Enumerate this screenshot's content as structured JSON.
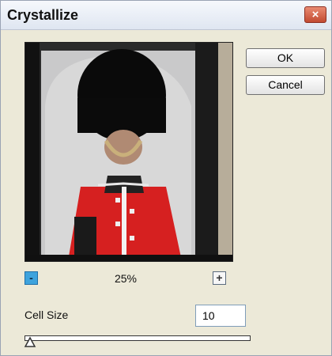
{
  "dialog": {
    "title": "Crystallize"
  },
  "buttons": {
    "ok": "OK",
    "cancel": "Cancel"
  },
  "zoom": {
    "out_symbol": "-",
    "in_symbol": "+",
    "level": "25%"
  },
  "cell_size": {
    "label": "Cell Size",
    "value": "10",
    "slider_level_fraction": 0.0
  },
  "preview": {
    "description_icon": "image-preview"
  },
  "colors": {
    "accent": "#3ea3dd",
    "close": "#c24a31",
    "dialog_bg": "#ece9d8"
  }
}
